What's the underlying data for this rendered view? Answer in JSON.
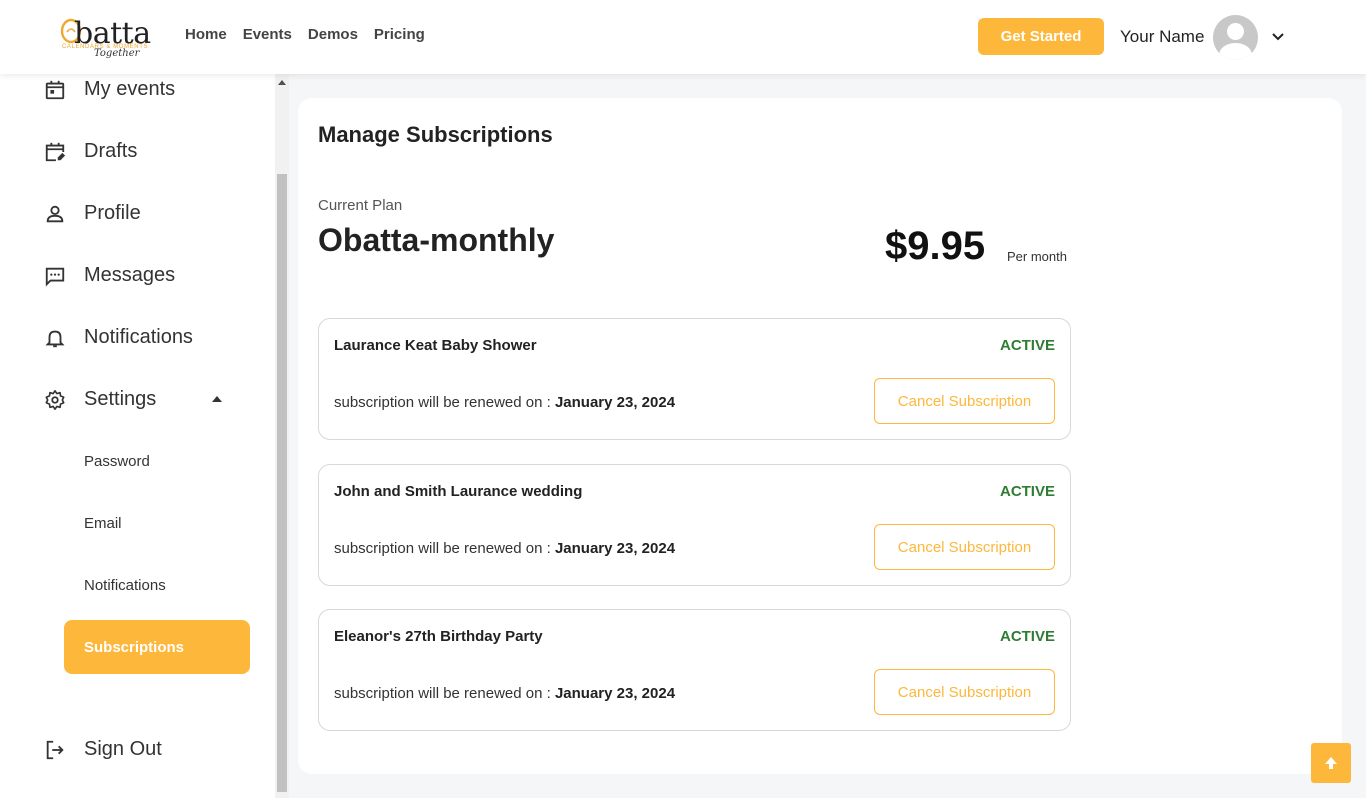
{
  "header": {
    "logo": {
      "word": "batta",
      "tagline": "CALENDARS & MOMENTS",
      "script": "Together"
    },
    "nav": [
      "Home",
      "Events",
      "Demos",
      "Pricing"
    ],
    "cta_label": "Get Started",
    "user_name": "Your Name"
  },
  "sidebar": {
    "items": {
      "my_events": "My events",
      "drafts": "Drafts",
      "profile": "Profile",
      "messages": "Messages",
      "notifications": "Notifications",
      "settings": "Settings",
      "sign_out": "Sign Out"
    },
    "settings_sub": {
      "password": "Password",
      "email": "Email",
      "notifications": "Notifications",
      "subscriptions": "Subscriptions"
    }
  },
  "main": {
    "title": "Manage Subscriptions",
    "plan_label": "Current Plan",
    "plan_name": "Obatta-monthly",
    "price": "$9.95",
    "price_period": "Per month",
    "renew_prefix": "subscription will be renewed on : ",
    "subscriptions": [
      {
        "name": "Laurance Keat Baby Shower",
        "status": "ACTIVE",
        "renew_date": "January 23, 2024",
        "action": "Cancel Subscription"
      },
      {
        "name": "John and Smith Laurance wedding",
        "status": "ACTIVE",
        "renew_date": "January 23, 2024",
        "action": "Cancel Subscription"
      },
      {
        "name": "Eleanor's 27th Birthday Party",
        "status": "ACTIVE",
        "renew_date": "January 23, 2024",
        "action": "Cancel Subscription"
      }
    ]
  },
  "colors": {
    "accent": "#fdb73b",
    "active_status": "#2e7d32"
  }
}
